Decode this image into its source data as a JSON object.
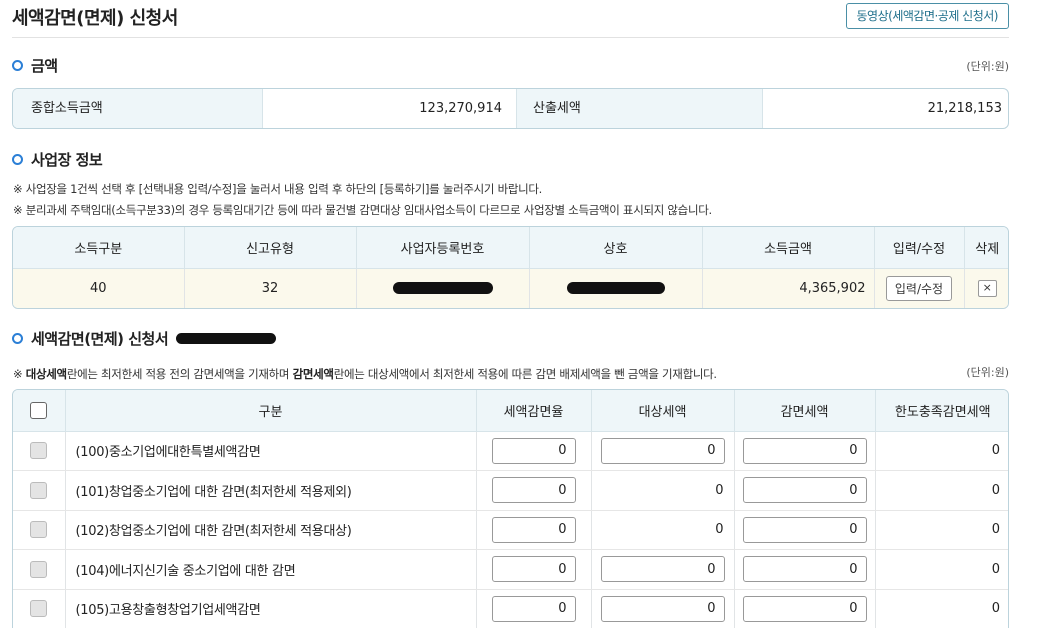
{
  "header": {
    "title": "세액감면(면제) 신청서",
    "video_button": "동영상(세액감면·공제 신청서)"
  },
  "amount_section": {
    "title": "금액",
    "unit": "(단위:원)",
    "total_income_label": "종합소득금액",
    "total_income_value": "123,270,914",
    "calculated_tax_label": "산출세액",
    "calculated_tax_value": "21,218,153"
  },
  "business_section": {
    "title": "사업장 정보",
    "note1": "※ 사업장을 1건씩 선택 후 [선택내용 입력/수정]을 눌러서 내용 입력 후 하단의 [등록하기]를 눌러주시기 바랍니다.",
    "note2": "※ 분리과세 주택임대(소득구분33)의 경우 등록임대기간 등에 따라 물건별 감면대상  임대사업소득이 다르므로 사업장별 소득금액이 표시되지 않습니다.",
    "columns": [
      "소득구분",
      "신고유형",
      "사업자등록번호",
      "상호",
      "소득금액",
      "입력/수정",
      "삭제"
    ],
    "row": {
      "income_type": "40",
      "report_type": "32",
      "income_amount": "4,365,902",
      "edit_label": "입력/수정",
      "delete_label": "×"
    }
  },
  "reduction_section": {
    "title": "세액감면(면제) 신청서",
    "note_prefix": "※ ",
    "note_bold1": "대상세액",
    "note_mid": "란에는 최저한세 적용 전의 감면세액을 기재하며 ",
    "note_bold2": "감면세액",
    "note_suffix": "란에는 대상세액에서 최저한세 적용에 따른 감면 배제세액을 뺀 금액을 기재합니다.",
    "unit": "(단위:원)",
    "columns": [
      "구분",
      "세액감면율",
      "대상세액",
      "감면세액",
      "한도충족감면세액"
    ],
    "rows": [
      {
        "name": "(100)중소기업에대한특별세액감면",
        "rate": "0",
        "target": "0",
        "reduction": "0",
        "limit": "0"
      },
      {
        "name": "(101)창업중소기업에 대한 감면(최저한세 적용제외)",
        "rate": "0",
        "target": "0",
        "reduction": "0",
        "limit": "0"
      },
      {
        "name": "(102)창업중소기업에 대한 감면(최저한세 적용대상)",
        "rate": "0",
        "target": "0",
        "reduction": "0",
        "limit": "0"
      },
      {
        "name": "(104)에너지신기술 중소기업에 대한 감면",
        "rate": "0",
        "target": "0",
        "reduction": "0",
        "limit": "0"
      },
      {
        "name": "(105)고용창출형창업기업세액감면",
        "rate": "0",
        "target": "0",
        "reduction": "0",
        "limit": "0"
      }
    ]
  },
  "colors": {
    "accent": "#2b7fd6",
    "header_bg": "#eef6f9",
    "row_highlight": "#fbf9ec",
    "border": "#bcd3dc"
  }
}
